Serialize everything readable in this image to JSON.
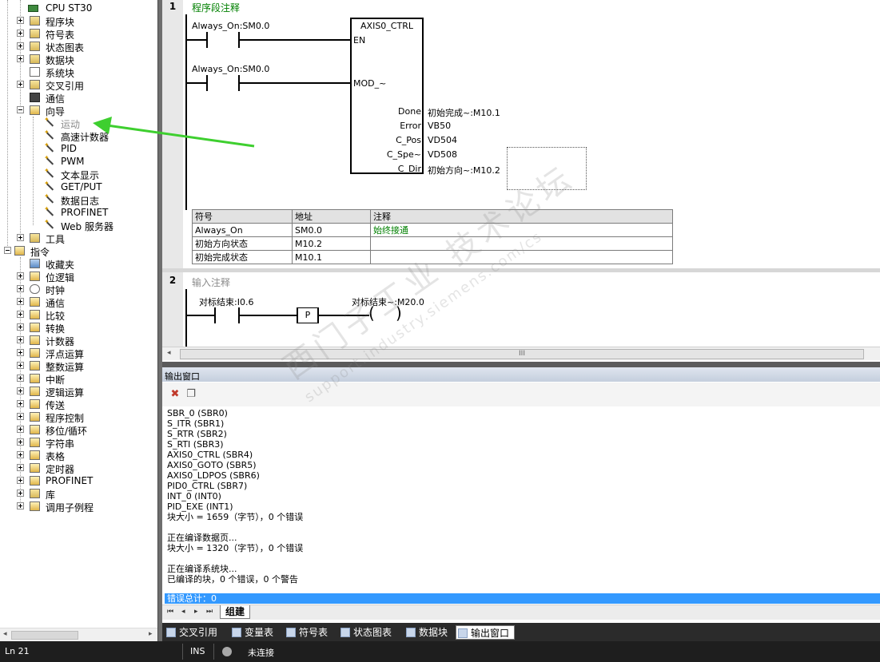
{
  "tree": {
    "items": [
      {
        "label": "CPU ST30",
        "icon": "cpu-icon"
      },
      {
        "label": "程序块",
        "icon": "folder-icon"
      },
      {
        "label": "符号表",
        "icon": "folder-icon"
      },
      {
        "label": "状态图表",
        "icon": "folder-icon"
      },
      {
        "label": "数据块",
        "icon": "folder-icon"
      },
      {
        "label": "系统块",
        "icon": "document-icon"
      },
      {
        "label": "交叉引用",
        "icon": "folder-icon"
      },
      {
        "label": "通信",
        "icon": "computer-icon"
      },
      {
        "label": "向导",
        "icon": "wizard-folder-icon"
      },
      {
        "label": "运动",
        "icon": "wand-icon"
      },
      {
        "label": "高速计数器",
        "icon": "wand-icon"
      },
      {
        "label": "PID",
        "icon": "wand-icon"
      },
      {
        "label": "PWM",
        "icon": "wand-icon"
      },
      {
        "label": "文本显示",
        "icon": "wand-icon"
      },
      {
        "label": "GET/PUT",
        "icon": "wand-icon"
      },
      {
        "label": "数据日志",
        "icon": "wand-icon"
      },
      {
        "label": "PROFINET",
        "icon": "wand-icon"
      },
      {
        "label": "Web 服务器",
        "icon": "wand-icon"
      },
      {
        "label": "工具",
        "icon": "folder-icon"
      },
      {
        "label": "指令",
        "icon": "instructions-icon"
      },
      {
        "label": "收藏夹",
        "icon": "favorites-icon"
      },
      {
        "label": "位逻辑",
        "icon": "instruction-group-icon"
      },
      {
        "label": "时钟",
        "icon": "clock-icon"
      },
      {
        "label": "通信",
        "icon": "instruction-group-icon"
      },
      {
        "label": "比较",
        "icon": "instruction-group-icon"
      },
      {
        "label": "转换",
        "icon": "instruction-group-icon"
      },
      {
        "label": "计数器",
        "icon": "instruction-group-icon"
      },
      {
        "label": "浮点运算",
        "icon": "instruction-group-icon"
      },
      {
        "label": "整数运算",
        "icon": "instruction-group-icon"
      },
      {
        "label": "中断",
        "icon": "instruction-group-icon"
      },
      {
        "label": "逻辑运算",
        "icon": "instruction-group-icon"
      },
      {
        "label": "传送",
        "icon": "instruction-group-icon"
      },
      {
        "label": "程序控制",
        "icon": "instruction-group-icon"
      },
      {
        "label": "移位/循环",
        "icon": "instruction-group-icon"
      },
      {
        "label": "字符串",
        "icon": "instruction-group-icon"
      },
      {
        "label": "表格",
        "icon": "instruction-group-icon"
      },
      {
        "label": "定时器",
        "icon": "instruction-group-icon"
      },
      {
        "label": "PROFINET",
        "icon": "instruction-group-icon"
      },
      {
        "label": "库",
        "icon": "library-icon"
      },
      {
        "label": "调用子例程",
        "icon": "instruction-group-icon"
      }
    ]
  },
  "editor": {
    "network1": {
      "number": "1",
      "comment": "程序段注释",
      "contact1": "Always_On:SM0.0",
      "contact2": "Always_On:SM0.0",
      "box_title": "AXIS0_CTRL",
      "pin_en": "EN",
      "pin_mod": "MOD_~",
      "outputs": [
        {
          "pin": "Done",
          "operand": "初始完成~:M10.1"
        },
        {
          "pin": "Error",
          "operand": "VB50"
        },
        {
          "pin": "C_Pos",
          "operand": "VD504"
        },
        {
          "pin": "C_Spe~",
          "operand": "VD508"
        },
        {
          "pin": "C_Dir",
          "operand": "初始方向~:M10.2"
        }
      ],
      "symbol_table": {
        "headers": [
          "符号",
          "地址",
          "注释"
        ],
        "rows": [
          [
            "Always_On",
            "SM0.0",
            "始终接通"
          ],
          [
            "初始方向状态",
            "M10.2",
            ""
          ],
          [
            "初始完成状态",
            "M10.1",
            ""
          ]
        ]
      }
    },
    "network2": {
      "number": "2",
      "comment": "输入注释",
      "contact": "对标结束:I0.6",
      "p_label": "P",
      "coil": "对标结束~:M20.0"
    },
    "scroll_grip": "III"
  },
  "output": {
    "title": "输出窗口",
    "lines": [
      "SBR_0 (SBR0)",
      "S_ITR (SBR1)",
      "S_RTR (SBR2)",
      "S_RTI (SBR3)",
      "AXIS0_CTRL (SBR4)",
      "AXIS0_GOTO (SBR5)",
      "AXIS0_LDPOS (SBR6)",
      "PID0_CTRL (SBR7)",
      "INT_0 (INT0)",
      "PID_EXE (INT1)",
      "块大小 = 1659（字节），0 个错误",
      "",
      "正在编译数据页...",
      "块大小 = 1320（字节），0 个错误",
      "",
      "正在编译系统块...",
      "已编译的块，0 个错误，0 个警告"
    ],
    "error_total": "错误总计：0",
    "build_tab": "组建"
  },
  "bottom_tabs": [
    {
      "label": "交叉引用",
      "icon": "cross-reference-icon"
    },
    {
      "label": "变量表",
      "icon": "variable-table-icon"
    },
    {
      "label": "符号表",
      "icon": "symbol-table-icon"
    },
    {
      "label": "状态图表",
      "icon": "status-chart-icon"
    },
    {
      "label": "数据块",
      "icon": "data-block-icon"
    },
    {
      "label": "输出窗口",
      "icon": "output-window-icon"
    }
  ],
  "status": {
    "line": "Ln 21",
    "mode": "INS",
    "connection": "未连接"
  },
  "watermark": {
    "line1": "西门子工业 技术论坛",
    "line2": "support.industry.siemens.com/cs"
  },
  "colors": {
    "accent_green": "#008000",
    "arrow_green": "#3ecf2f",
    "error_bar": "#3399ff"
  }
}
